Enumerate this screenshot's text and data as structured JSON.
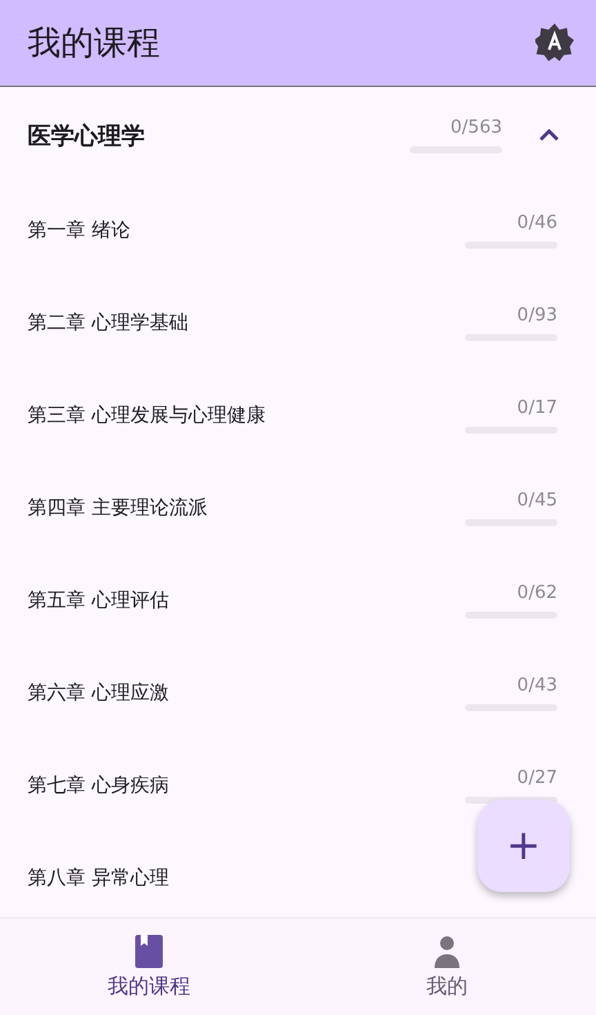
{
  "app_bar": {
    "title": "我的课程"
  },
  "course": {
    "name": "医学心理学",
    "count": "0/563",
    "level": 0,
    "expanded": true
  },
  "chapters": [
    {
      "title": "第一章 绪论",
      "count": "0/46",
      "level": 0
    },
    {
      "title": "第二章 心理学基础",
      "count": "0/93",
      "level": 0
    },
    {
      "title": "第三章 心理发展与心理健康",
      "count": "0/17",
      "level": 0
    },
    {
      "title": "第四章 主要理论流派",
      "count": "0/45",
      "level": 0
    },
    {
      "title": "第五章 心理评估",
      "count": "0/62",
      "level": 0
    },
    {
      "title": "第六章 心理应激",
      "count": "0/43",
      "level": 0
    },
    {
      "title": "第七章 心身疾病",
      "count": "0/27",
      "level": 0
    },
    {
      "title": "第八章 异常心理"
    }
  ],
  "fab": {
    "label": "+"
  },
  "nav": [
    {
      "label": "我的课程",
      "kind": "book",
      "selected": true
    },
    {
      "label": "我的",
      "kind": "person",
      "selected": false
    }
  ]
}
